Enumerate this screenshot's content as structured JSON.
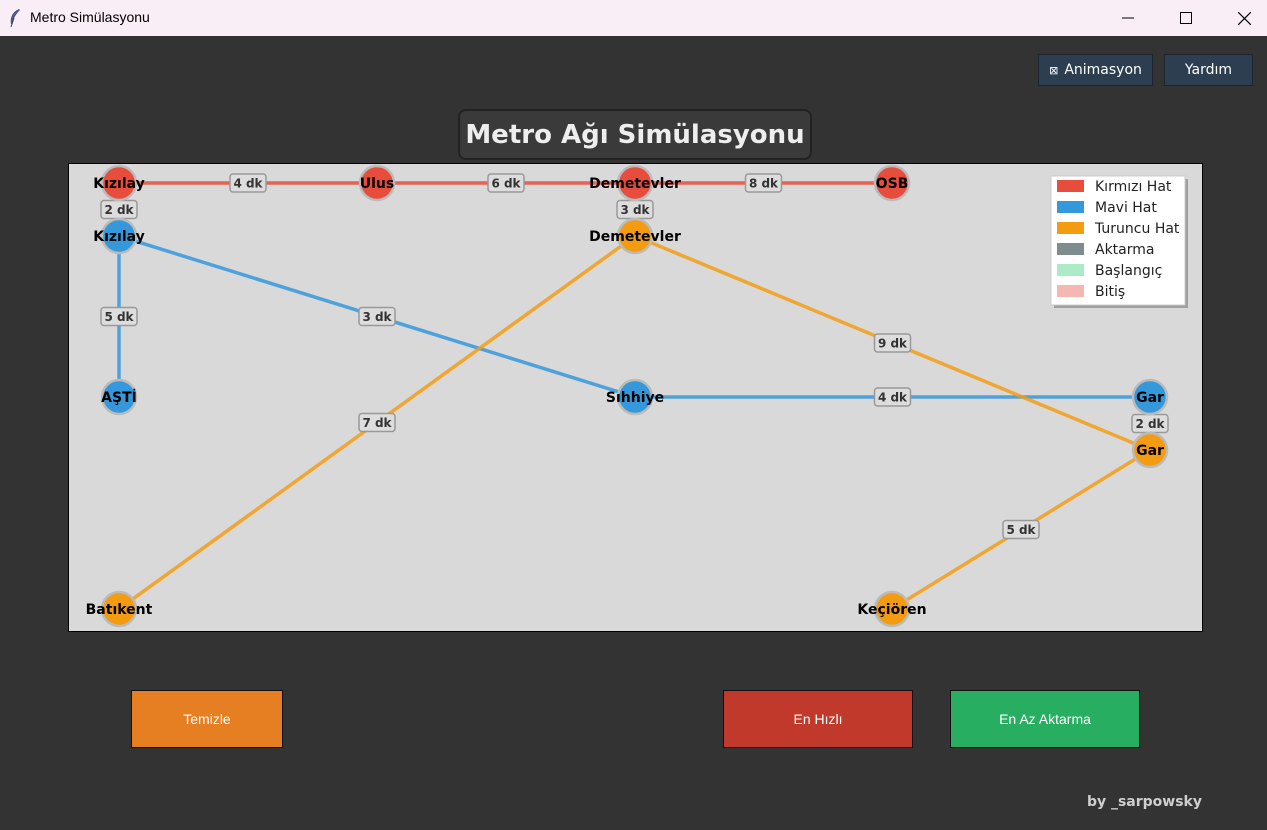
{
  "window": {
    "title": "Metro Simülasyonu",
    "icon": "feather-icon"
  },
  "controls": {
    "animation_label": "Animasyon",
    "animation_checked": false,
    "help_label": "Yardım"
  },
  "heading": "Metro Ağı Simülasyonu",
  "legend": [
    {
      "label": "Kırmızı Hat",
      "color": "#e74c3c"
    },
    {
      "label": "Mavi Hat",
      "color": "#3498db"
    },
    {
      "label": "Turuncu Hat",
      "color": "#f39c12"
    },
    {
      "label": "Aktarma",
      "color": "#7f8c8d"
    },
    {
      "label": "Başlangıç",
      "color": "#abebc6"
    },
    {
      "label": "Bitiş",
      "color": "#f5b7b1"
    }
  ],
  "stations": {
    "K1": {
      "name": "Kızılay",
      "line": "red"
    },
    "K2": {
      "name": "Ulus",
      "line": "red"
    },
    "K3": {
      "name": "Demetevler",
      "line": "red"
    },
    "K4": {
      "name": "OSB",
      "line": "red"
    },
    "M1": {
      "name": "AŞTİ",
      "line": "blue"
    },
    "M2": {
      "name": "Kızılay",
      "line": "blue"
    },
    "M3": {
      "name": "Sıhhiye",
      "line": "blue"
    },
    "M4": {
      "name": "Gar",
      "line": "blue"
    },
    "T1": {
      "name": "Batıkent",
      "line": "orange"
    },
    "T2": {
      "name": "Demetevler",
      "line": "orange"
    },
    "T3": {
      "name": "Gar",
      "line": "orange"
    },
    "T4": {
      "name": "Keçiören",
      "line": "orange"
    }
  },
  "connections": [
    {
      "from": "K1",
      "to": "K2",
      "label": "4 dk",
      "line": "red"
    },
    {
      "from": "K2",
      "to": "K3",
      "label": "6 dk",
      "line": "red"
    },
    {
      "from": "K3",
      "to": "K4",
      "label": "8 dk",
      "line": "red"
    },
    {
      "from": "M2",
      "to": "M1",
      "label": "5 dk",
      "line": "blue"
    },
    {
      "from": "M2",
      "to": "M3",
      "label": "3 dk",
      "line": "blue"
    },
    {
      "from": "M3",
      "to": "M4",
      "label": "4 dk",
      "line": "blue"
    },
    {
      "from": "T1",
      "to": "T2",
      "label": "7 dk",
      "line": "orange"
    },
    {
      "from": "T2",
      "to": "T3",
      "label": "9 dk",
      "line": "orange"
    },
    {
      "from": "T3",
      "to": "T4",
      "label": "5 dk",
      "line": "orange"
    },
    {
      "from": "K1",
      "to": "M2",
      "label": "2 dk",
      "line": "transfer"
    },
    {
      "from": "K3",
      "to": "T2",
      "label": "3 dk",
      "line": "transfer"
    },
    {
      "from": "M4",
      "to": "T3",
      "label": "2 dk",
      "line": "transfer"
    }
  ],
  "line_colors": {
    "red": "#e74c3c",
    "blue": "#3498db",
    "orange": "#f39c12",
    "transfer": "#aaaaaa"
  },
  "plot_background": "#d9d9d9",
  "actions": {
    "clear_label": "Temizle",
    "clear_color": "#e67e22",
    "fastest_label": "En Hızlı",
    "fastest_color": "#c0392b",
    "fewest_transfers_label": "En Az Aktarma",
    "fewest_transfers_color": "#27ae60"
  },
  "credit": "by _sarpowsky"
}
